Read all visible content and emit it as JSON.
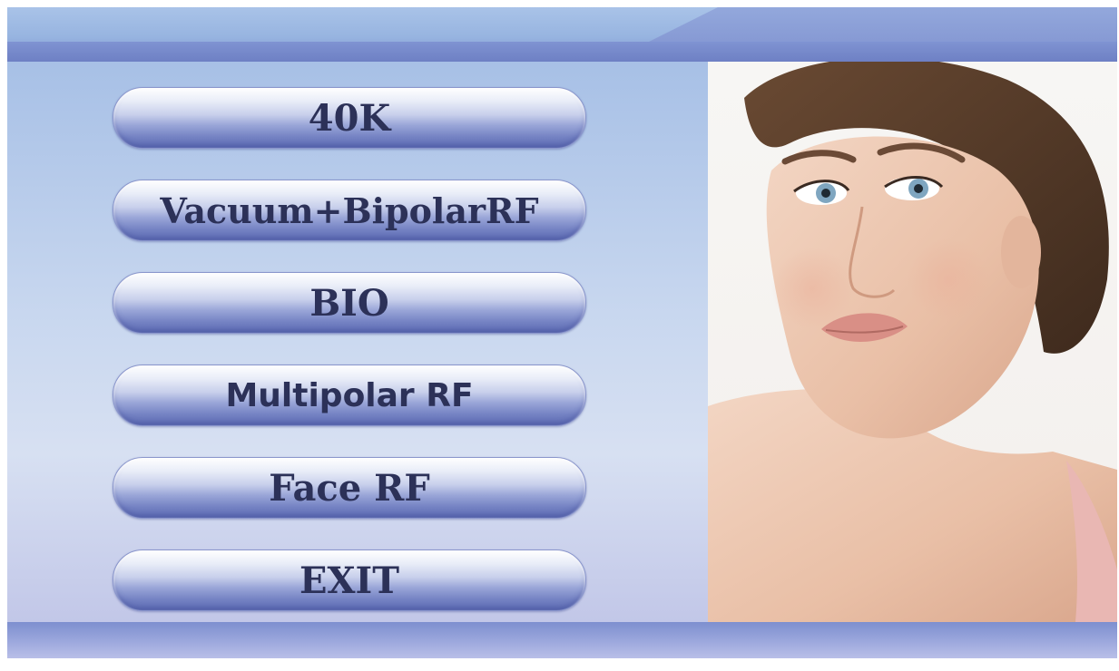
{
  "menu": {
    "buttons": [
      {
        "label": "40K"
      },
      {
        "label": "Vacuum+BipolarRF"
      },
      {
        "label": "BIO"
      },
      {
        "label": "Multipolar RF"
      },
      {
        "label": "Face RF"
      },
      {
        "label": "EXIT"
      }
    ]
  },
  "colors": {
    "banner": "#7d8fcf",
    "panel": "#c8d7ef",
    "button_text": "#2c3158"
  },
  "photo": {
    "icon": "portrait-photo"
  }
}
